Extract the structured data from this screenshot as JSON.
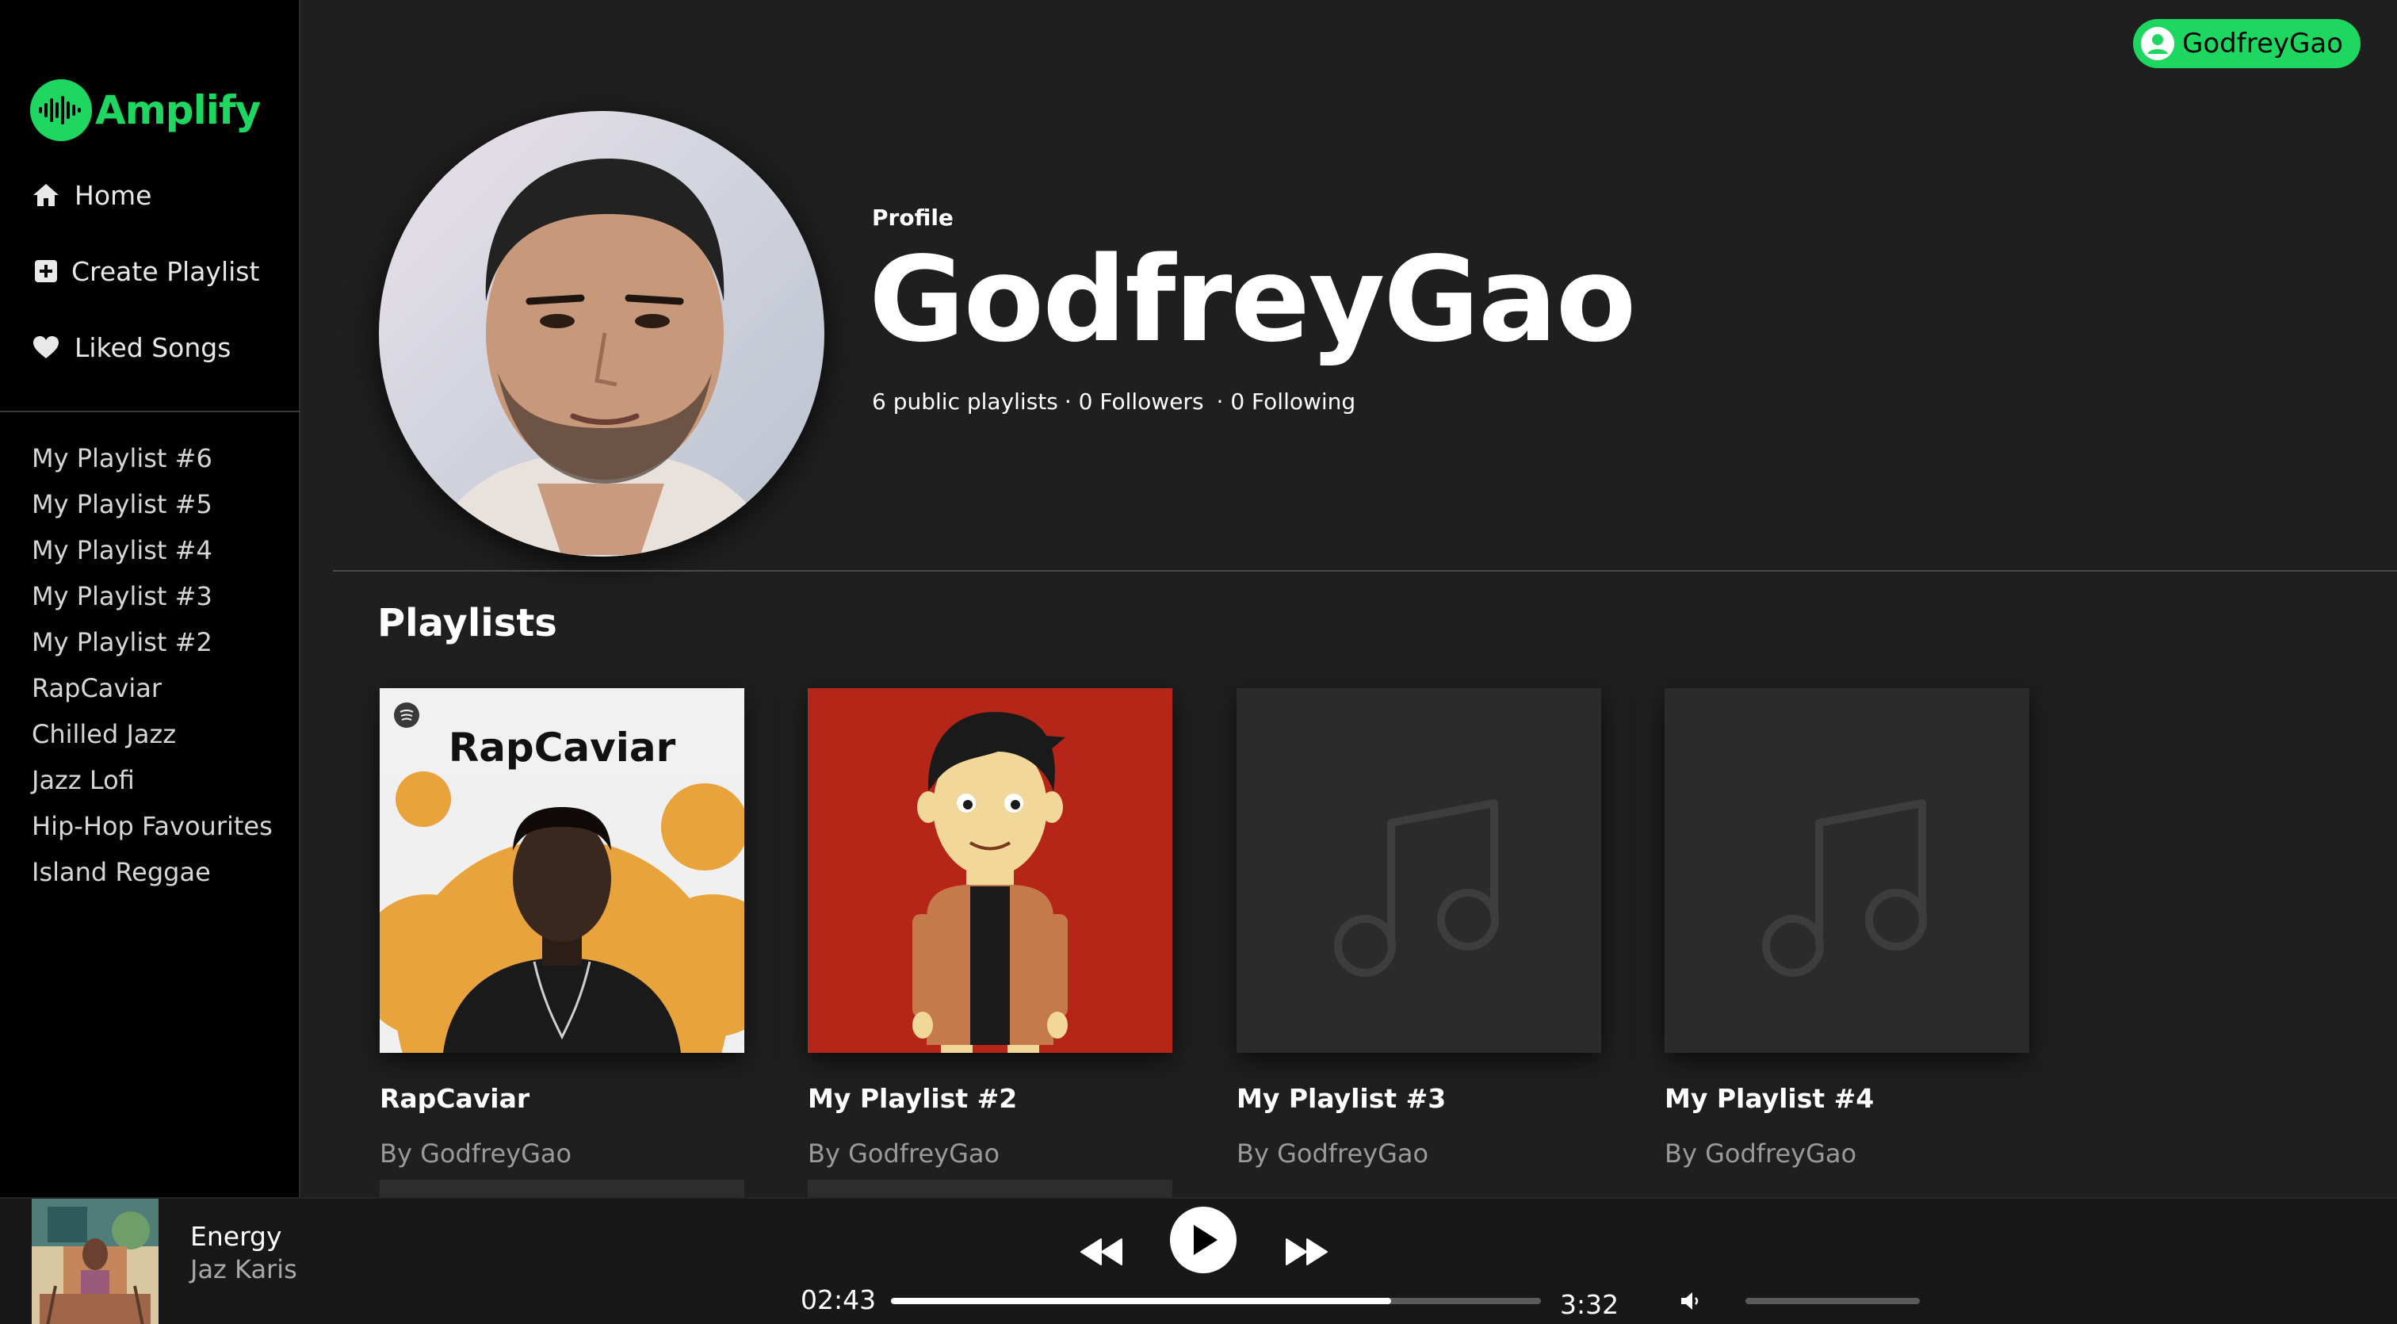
{
  "app": {
    "name": "Amplify"
  },
  "sidebar": {
    "nav": [
      {
        "label": "Home",
        "icon": "home-icon"
      },
      {
        "label": "Create Playlist",
        "icon": "plus-square-icon"
      },
      {
        "label": "Liked Songs",
        "icon": "heart-icon"
      }
    ],
    "playlists": [
      "My Playlist #6",
      "My Playlist #5",
      "My Playlist #4",
      "My Playlist #3",
      "My Playlist #2",
      "RapCaviar",
      "Chilled Jazz",
      "Jazz Lofi",
      "Hip-Hop Favourites",
      "Island Reggae"
    ]
  },
  "user_menu": {
    "username": "GodfreyGao",
    "icon": "user-circle-icon"
  },
  "profile": {
    "kind": "Profile",
    "name": "GodfreyGao",
    "stats": [
      "6 public playlists",
      "· 0 Followers",
      "· 0 Following"
    ]
  },
  "playlists_section": {
    "title": "Playlists",
    "cards": [
      {
        "title": "RapCaviar",
        "byline": "By GodfreyGao",
        "cover": "rapcaviar-art",
        "cover_text": "RapCaviar"
      },
      {
        "title": "My Playlist #2",
        "byline": "By GodfreyGao",
        "cover": "cartoon-man-art"
      },
      {
        "title": "My Playlist #3",
        "byline": "By GodfreyGao",
        "cover": "music-note-placeholder"
      },
      {
        "title": "My Playlist #4",
        "byline": "By GodfreyGao",
        "cover": "music-note-placeholder"
      }
    ]
  },
  "player": {
    "track_title": "Energy",
    "artist": "Jaz Karis",
    "elapsed": "02:43",
    "duration": "3:32",
    "progress_fraction": 0.77,
    "volume_fraction": 0.0
  },
  "colors": {
    "accent": "#1ed760",
    "sidebar_bg": "#000000",
    "main_bg": "#1f1f1f",
    "player_bg": "#181818"
  }
}
